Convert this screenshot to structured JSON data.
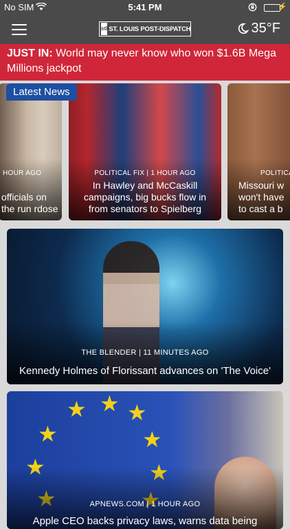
{
  "status_bar": {
    "carrier": "No SIM",
    "time": "5:41 PM",
    "battery_level": 1.0,
    "icons": [
      "wifi-icon",
      "rotation-lock-icon",
      "battery-icon",
      "charging-bolt-icon"
    ]
  },
  "header": {
    "logo_mark": "stl",
    "logo_text": "ST. LOUIS POST-DISPATCH",
    "weather_icon": "moon-icon",
    "temperature": "35°F"
  },
  "breaking": {
    "tag": "JUST IN:",
    "text": " World may never know who won $1.6B Mega Millions jackpot",
    "color": "#d0263a"
  },
  "carousel": {
    "badge": "Latest News",
    "badge_color": "#1f4fa0",
    "cards": [
      {
        "kicker": "HOUR AGO",
        "headline": "officials on the run rdose"
      },
      {
        "kicker": "POLITICAL FIX | 1 HOUR AGO",
        "headline": "In Hawley and McCaskill campaigns, big bucks flow in from senators to Spielberg"
      },
      {
        "kicker": "POLITICA",
        "headline": "Missouri w won't have to cast a b"
      }
    ]
  },
  "stories": [
    {
      "kicker": "THE BLENDER | 11 MINUTES AGO",
      "headline": "Kennedy Holmes of Florissant advances on 'The Voice'"
    },
    {
      "kicker": "APNEWS.COM | 1 HOUR AGO",
      "headline": "Apple CEO backs privacy laws, warns data being"
    }
  ]
}
